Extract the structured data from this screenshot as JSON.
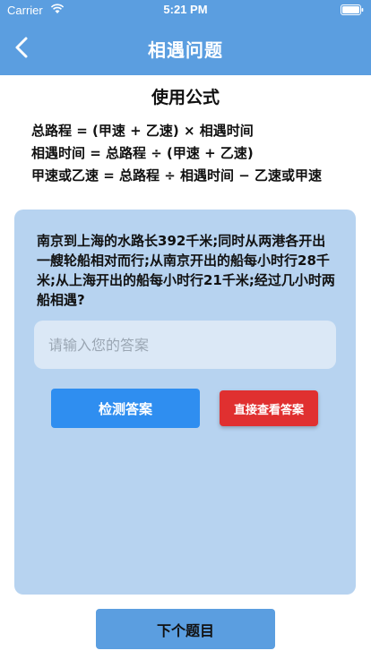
{
  "status_bar": {
    "carrier": "Carrier",
    "time": "5:21 PM"
  },
  "nav": {
    "title": "相遇问题",
    "back_icon": "chevron-left-icon"
  },
  "formulas": {
    "heading": "使用公式",
    "lines": [
      "总路程 = (甲速 + 乙速) × 相遇时间",
      "相遇时间 = 总路程 ÷ (甲速 + 乙速)",
      "甲速或乙速 = 总路程 ÷ 相遇时间 − 乙速或甲速"
    ]
  },
  "question": {
    "text": "南京到上海的水路长392千米;同时从两港各开出一艘轮船相对而行;从南京开出的船每小时行28千米;从上海开出的船每小时行21千米;经过几小时两船相遇?",
    "answer_placeholder": "请输入您的答案",
    "check_label": "检测答案",
    "show_answer_label": "直接查看答案"
  },
  "next_label": "下个题目",
  "colors": {
    "accent": "#5b9ee0",
    "card": "#b7d3f0",
    "primary_button": "#2f8ef0",
    "danger_button": "#e03030"
  }
}
